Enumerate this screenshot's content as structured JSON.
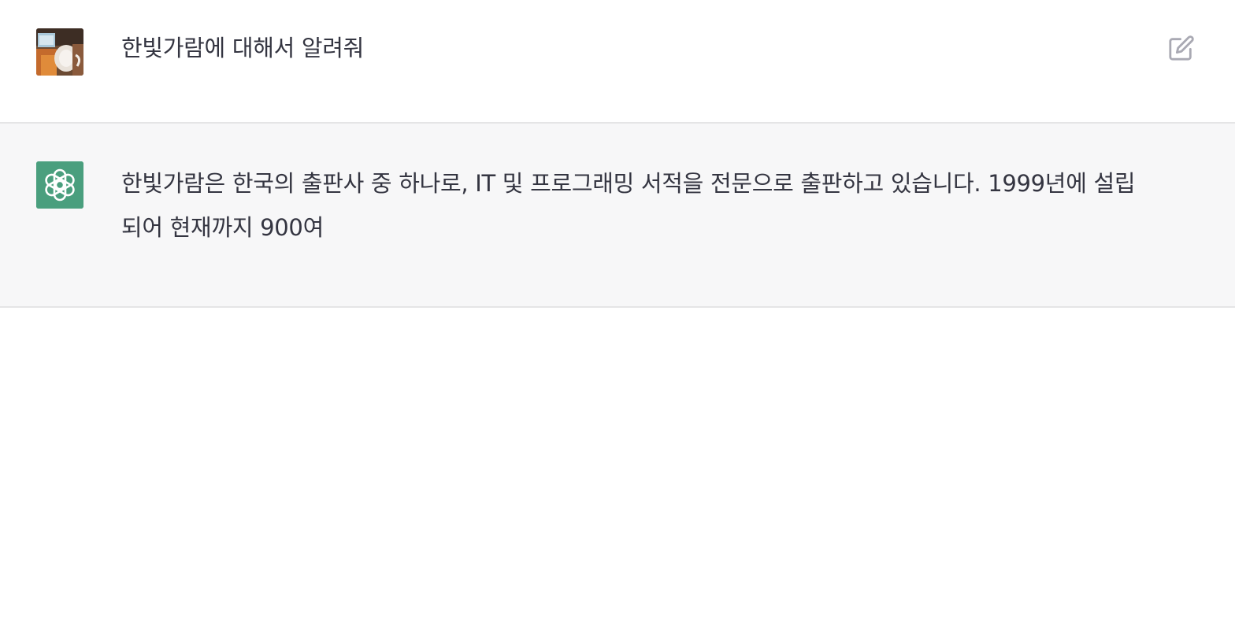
{
  "conversation": {
    "user_message": {
      "avatar_icon": "user-photo-avatar",
      "text": "한빛가람에 대해서 알려줘",
      "action_icon": "edit-icon"
    },
    "assistant_message": {
      "avatar_icon": "openai-logo-icon",
      "avatar_color": "#4a9f7e",
      "text": "한빛가람은 한국의 출판사 중 하나로, IT 및 프로그래밍 서적을 전문으로 출판하고 있습니다. 1999년에 설립되어 현재까지 900여"
    }
  }
}
